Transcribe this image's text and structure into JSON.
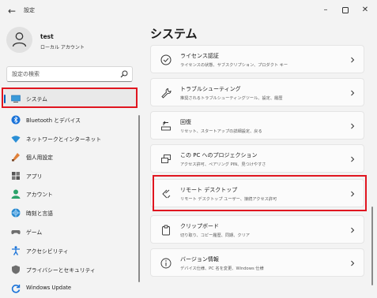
{
  "window": {
    "title": "設定"
  },
  "user": {
    "name": "test",
    "account_type": "ローカル アカウント"
  },
  "search": {
    "placeholder": "設定の検索"
  },
  "nav": {
    "items": [
      {
        "label": "システム",
        "icon": "system-icon",
        "active": true
      },
      {
        "label": "Bluetooth とデバイス",
        "icon": "bluetooth-icon"
      },
      {
        "label": "ネットワークとインターネット",
        "icon": "network-icon"
      },
      {
        "label": "個人用設定",
        "icon": "personalization-icon"
      },
      {
        "label": "アプリ",
        "icon": "apps-icon"
      },
      {
        "label": "アカウント",
        "icon": "accounts-icon"
      },
      {
        "label": "時刻と言語",
        "icon": "time-language-icon"
      },
      {
        "label": "ゲーム",
        "icon": "gaming-icon"
      },
      {
        "label": "アクセシビリティ",
        "icon": "accessibility-icon"
      },
      {
        "label": "プライバシーとセキュリティ",
        "icon": "privacy-icon"
      },
      {
        "label": "Windows Update",
        "icon": "windows-update-icon"
      }
    ]
  },
  "main": {
    "title": "システム",
    "cards": [
      {
        "title": "ライセンス認証",
        "subtitle": "ライセンスの状態、サブスクリプション、プロダクト キー",
        "icon": "activation-icon"
      },
      {
        "title": "トラブルシューティング",
        "subtitle": "推奨されるトラブルシューティングツール、設定、履歴",
        "icon": "troubleshoot-icon"
      },
      {
        "title": "回復",
        "subtitle": "リセット、スタートアップの詳細設定、戻る",
        "icon": "recovery-icon"
      },
      {
        "title": "この PC へのプロジェクション",
        "subtitle": "アクセス許可、ペアリング PIN、見つけやすさ",
        "icon": "projection-icon"
      },
      {
        "title": "リモート デスクトップ",
        "subtitle": "リモート デスクトップ ユーザー、接続アクセス許可",
        "icon": "remote-desktop-icon",
        "highlighted": true
      },
      {
        "title": "クリップボード",
        "subtitle": "切り取り、コピー履歴、同期、クリア",
        "icon": "clipboard-icon"
      },
      {
        "title": "バージョン情報",
        "subtitle": "デバイス仕様、PC 名を変更、Windows 仕様",
        "icon": "about-icon"
      }
    ]
  },
  "colors": {
    "accent": "#005fb8",
    "highlight": "#e0151f",
    "background": "#f3f3f3",
    "card": "#fbfbfb"
  }
}
